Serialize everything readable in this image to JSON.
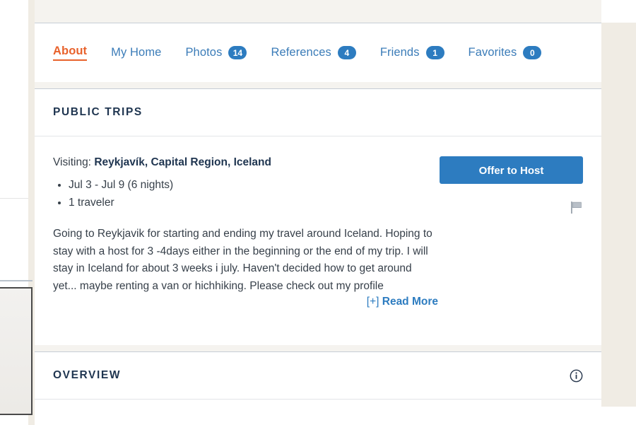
{
  "tabs": [
    {
      "label": "About",
      "badge": null,
      "active": true
    },
    {
      "label": "My Home",
      "badge": null,
      "active": false
    },
    {
      "label": "Photos",
      "badge": "14",
      "active": false
    },
    {
      "label": "References",
      "badge": "4",
      "active": false
    },
    {
      "label": "Friends",
      "badge": "1",
      "active": false
    },
    {
      "label": "Favorites",
      "badge": "0",
      "active": false
    }
  ],
  "public_trips": {
    "section_title": "PUBLIC TRIPS",
    "visiting_label": "Visiting:",
    "destination": "Reykjavík, Capital Region, Iceland",
    "facts": [
      "Jul 3 - Jul 9 (6 nights)",
      "1 traveler"
    ],
    "description": "Going to Reykjavik for starting and ending my travel around Iceland. Hoping to stay with a host for 3 -4days either in the beginning or the end of my trip. I will stay in Iceland for about 3 weeks i july. Haven't decided how to get around yet... maybe renting a van or hichhiking. Please check out my profile",
    "read_more_prefix": "[+] ",
    "read_more_label": "Read More",
    "offer_to_host_label": "Offer to Host",
    "flag_icon": "flag-icon"
  },
  "overview": {
    "section_title": "OVERVIEW",
    "info_icon": "info-icon"
  },
  "colors": {
    "accent_orange": "#e8622c",
    "link_blue": "#3b7cb8",
    "button_blue": "#2d7cc0",
    "heading_navy": "#1f3550",
    "body_text": "#37404a",
    "page_bg": "#f0ece4",
    "divider": "#c6cdd6"
  }
}
